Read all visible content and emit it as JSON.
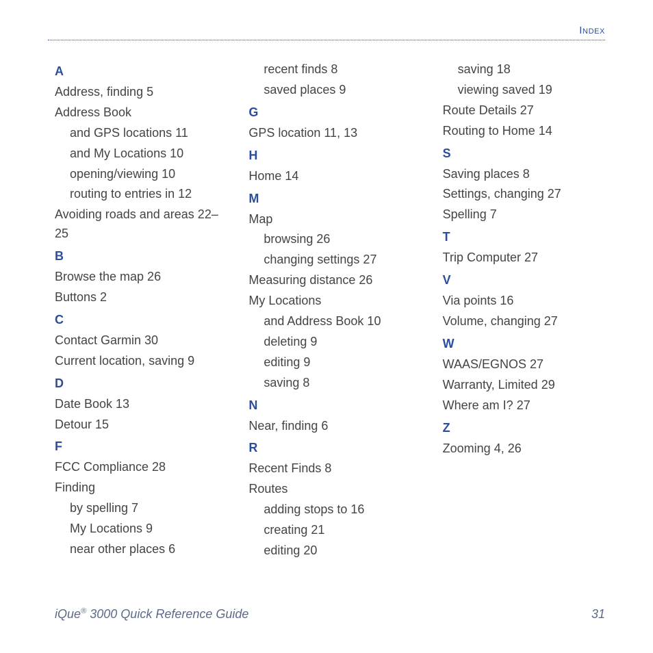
{
  "header": "Index",
  "footer": {
    "product": "iQue",
    "reg": "®",
    "title_rest": " 3000 Quick Reference Guide",
    "page": "31"
  },
  "columns": [
    [
      {
        "type": "letter",
        "t": "A"
      },
      {
        "type": "entry",
        "t": "Address, finding  5"
      },
      {
        "type": "entry",
        "t": "Address Book"
      },
      {
        "type": "sub",
        "t": "and GPS locations  11"
      },
      {
        "type": "sub",
        "t": "and My Locations  10"
      },
      {
        "type": "sub",
        "t": "opening/viewing  10"
      },
      {
        "type": "sub",
        "t": "routing to entries in  12"
      },
      {
        "type": "entry",
        "t": "Avoiding roads and areas  22–25"
      },
      {
        "type": "letter",
        "t": "B"
      },
      {
        "type": "entry",
        "t": "Browse the map  26"
      },
      {
        "type": "entry",
        "t": "Buttons  2"
      },
      {
        "type": "letter",
        "t": "C"
      },
      {
        "type": "entry",
        "t": "Contact Garmin  30"
      },
      {
        "type": "entry",
        "t": "Current location, saving  9"
      },
      {
        "type": "letter",
        "t": "D"
      },
      {
        "type": "entry",
        "t": "Date Book  13"
      },
      {
        "type": "entry",
        "t": "Detour  15"
      },
      {
        "type": "letter",
        "t": "F"
      },
      {
        "type": "entry",
        "t": "FCC Compliance  28"
      },
      {
        "type": "entry",
        "t": "Finding"
      },
      {
        "type": "sub",
        "t": "by spelling  7"
      },
      {
        "type": "sub",
        "t": "My Locations  9"
      },
      {
        "type": "sub",
        "t": "near other places  6"
      }
    ],
    [
      {
        "type": "sub",
        "t": "recent finds  8"
      },
      {
        "type": "sub",
        "t": "saved places  9"
      },
      {
        "type": "letter",
        "t": "G"
      },
      {
        "type": "entry",
        "t": "GPS location  11, 13"
      },
      {
        "type": "letter",
        "t": "H"
      },
      {
        "type": "entry",
        "t": "Home  14"
      },
      {
        "type": "letter",
        "t": "M"
      },
      {
        "type": "entry",
        "t": "Map"
      },
      {
        "type": "sub",
        "t": "browsing  26"
      },
      {
        "type": "sub",
        "t": "changing settings  27"
      },
      {
        "type": "entry",
        "t": "Measuring distance  26"
      },
      {
        "type": "entry",
        "t": "My Locations"
      },
      {
        "type": "sub",
        "t": "and Address Book  10"
      },
      {
        "type": "sub",
        "t": "deleting  9"
      },
      {
        "type": "sub",
        "t": "editing  9"
      },
      {
        "type": "sub",
        "t": "saving  8"
      },
      {
        "type": "letter",
        "t": "N"
      },
      {
        "type": "entry",
        "t": "Near, finding  6"
      },
      {
        "type": "letter",
        "t": "R"
      },
      {
        "type": "entry",
        "t": "Recent Finds  8"
      },
      {
        "type": "entry",
        "t": "Routes"
      },
      {
        "type": "sub",
        "t": "adding stops to  16"
      },
      {
        "type": "sub",
        "t": "creating  21"
      },
      {
        "type": "sub",
        "t": "editing  20"
      }
    ],
    [
      {
        "type": "sub",
        "t": "saving  18"
      },
      {
        "type": "sub",
        "t": "viewing saved  19"
      },
      {
        "type": "entry",
        "t": "Route Details  27"
      },
      {
        "type": "entry",
        "t": "Routing to Home  14"
      },
      {
        "type": "letter",
        "t": "S"
      },
      {
        "type": "entry",
        "t": "Saving places  8"
      },
      {
        "type": "entry",
        "t": "Settings, changing  27"
      },
      {
        "type": "entry",
        "t": "Spelling  7"
      },
      {
        "type": "letter",
        "t": "T"
      },
      {
        "type": "entry",
        "t": "Trip Computer  27"
      },
      {
        "type": "letter",
        "t": "V"
      },
      {
        "type": "entry",
        "t": "Via points  16"
      },
      {
        "type": "entry",
        "t": "Volume, changing  27"
      },
      {
        "type": "letter",
        "t": "W"
      },
      {
        "type": "entry",
        "t": "WAAS/EGNOS  27"
      },
      {
        "type": "entry",
        "t": "Warranty, Limited  29"
      },
      {
        "type": "entry",
        "t": "Where am I?  27"
      },
      {
        "type": "letter",
        "t": "Z"
      },
      {
        "type": "entry",
        "t": "Zooming  4, 26"
      }
    ]
  ]
}
